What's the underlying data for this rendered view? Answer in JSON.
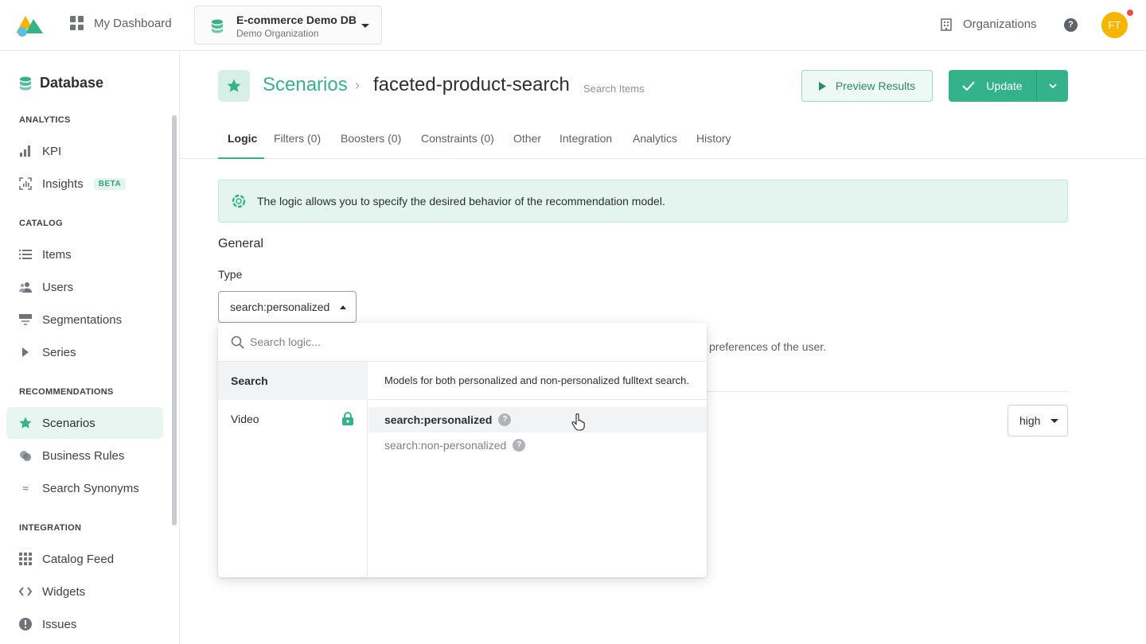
{
  "topbar": {
    "dashboard_label": "My Dashboard",
    "database_name": "E-commerce Demo DB",
    "organization_name": "Demo Organization",
    "organizations_label": "Organizations",
    "help_symbol": "?",
    "avatar_initials": "FT",
    "brand_color": "#34b28a"
  },
  "sidebar": {
    "title": "Database",
    "sections": {
      "analytics": "ANALYTICS",
      "catalog": "CATALOG",
      "recommendations": "RECOMMENDATIONS",
      "integration": "INTEGRATION"
    },
    "items": {
      "kpi": "KPI",
      "insights": "Insights",
      "insights_badge": "BETA",
      "items": "Items",
      "users": "Users",
      "segmentations": "Segmentations",
      "series": "Series",
      "scenarios": "Scenarios",
      "business_rules": "Business Rules",
      "search_synonyms": "Search Synonyms",
      "catalog_feed": "Catalog Feed",
      "widgets": "Widgets",
      "issues": "Issues"
    },
    "active_item": "Scenarios"
  },
  "header": {
    "breadcrumb": "Scenarios",
    "title": "faceted-product-search",
    "subtitle": "Search Items",
    "preview_label": "Preview Results",
    "update_label": "Update"
  },
  "tabs": [
    "Logic",
    "Filters (0)",
    "Boosters (0)",
    "Constraints (0)",
    "Other",
    "Integration",
    "Analytics",
    "History"
  ],
  "active_tab": "Logic",
  "info_banner": "The logic allows you to specify the desired behavior of the recommendation model.",
  "general": {
    "heading": "General",
    "type_label": "Type",
    "type_value": "search:personalized",
    "background_description": "l preferences of the user.",
    "priority_value": "high"
  },
  "dropdown": {
    "search_placeholder": "Search logic...",
    "categories": [
      {
        "label": "Search",
        "active": true,
        "locked": false
      },
      {
        "label": "Video",
        "active": false,
        "locked": true
      }
    ],
    "description": "Models for both personalized and non-personalized fulltext search.",
    "options": [
      {
        "label": "search:personalized",
        "hovered": true
      },
      {
        "label": "search:non-personalized",
        "hovered": false
      }
    ]
  }
}
